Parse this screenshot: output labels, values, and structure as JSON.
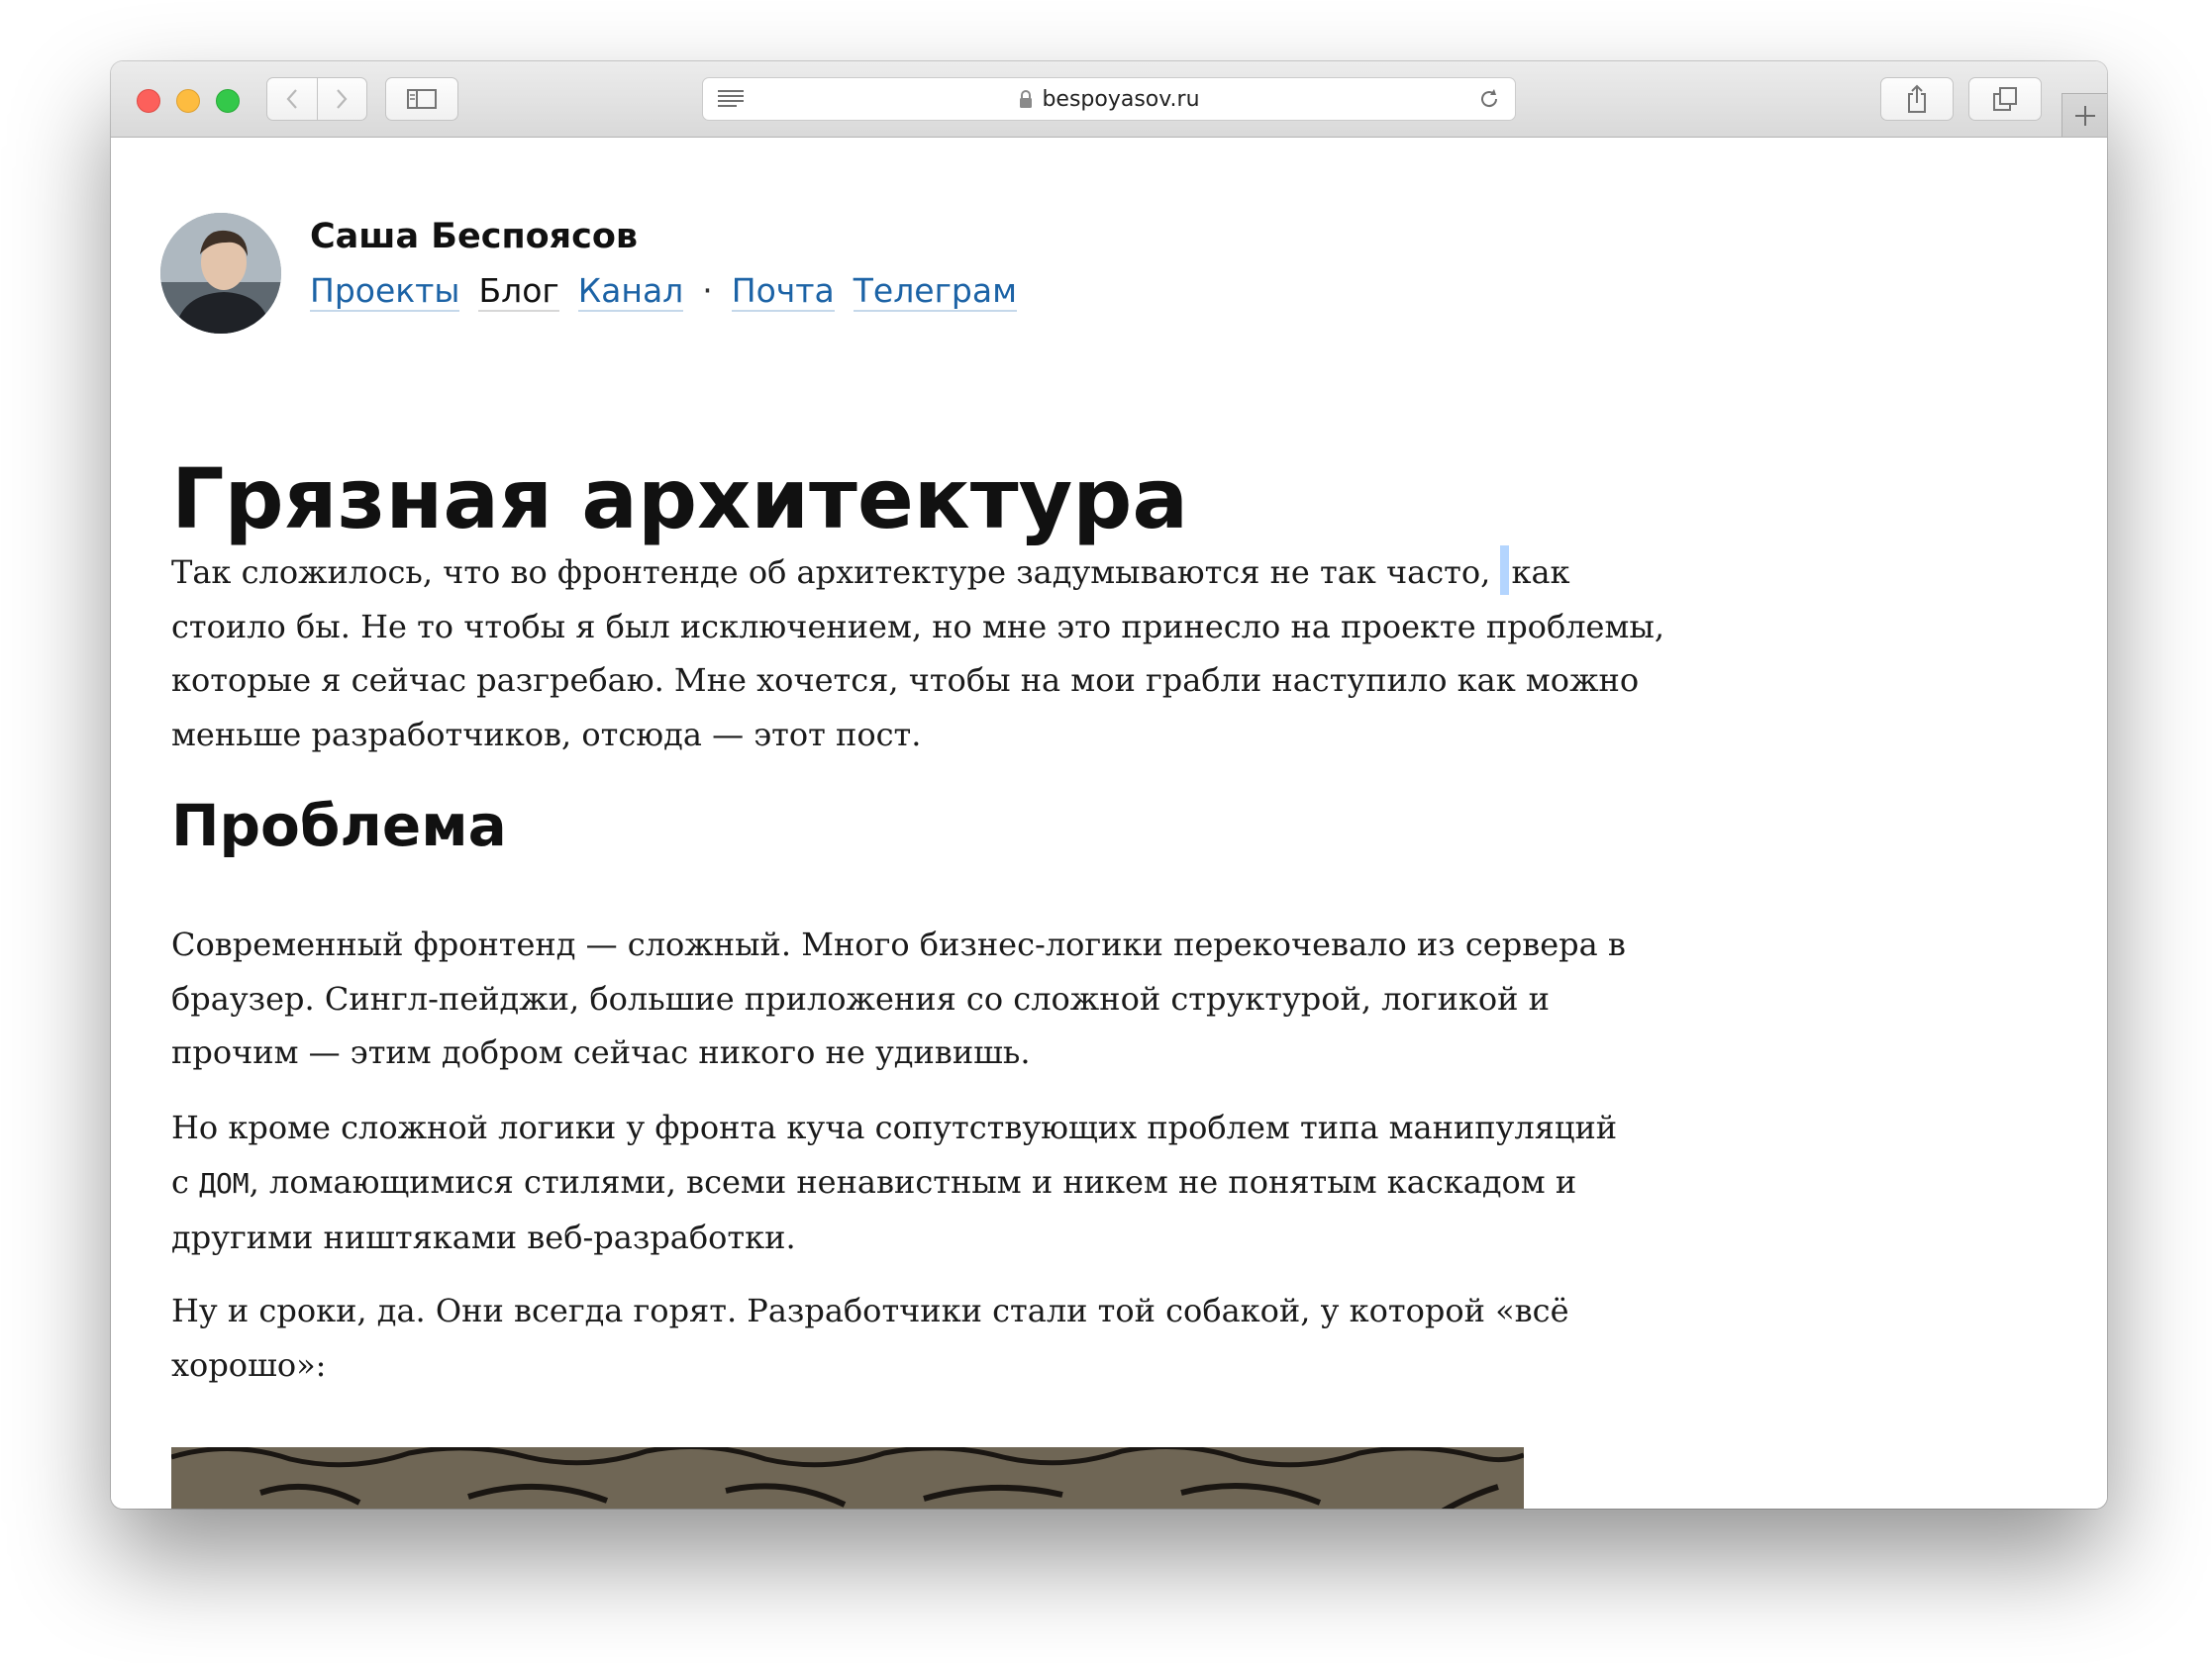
{
  "browser": {
    "url": "bespoyasov.ru",
    "colors": {
      "close": "#fc605b",
      "minimize": "#fdbc40",
      "maximize": "#34c84a"
    }
  },
  "site": {
    "author_name": "Саша Беспоясов",
    "nav": {
      "projects": "Проекты",
      "blog": "Блог",
      "channel": "Канал",
      "separator": "·",
      "mail": "Почта",
      "telegram": "Телеграм"
    },
    "link_color": "#1c63a6"
  },
  "article": {
    "title": "Грязная архитектура",
    "intro_before_caret": "Так сложилось, что во фронтенде об архитектуре задумываются не так часто, ",
    "intro_after_caret": "как стоило бы. Не то чтобы я был исключением, но мне это принесло на проекте проблемы, которые я сейчас разгребаю. Мне хочется, чтобы на мои грабли наступило как можно меньше разработчиков, отсюда — этот пост.",
    "section_title": "Проблема",
    "p2": "Современный фронтенд — сложный. Много бизнес-логики перекочевало из сервера в браузер. Сингл-пейджи, большие приложения со сложной структурой, логикой и прочим — этим добром сейчас никого не удивишь.",
    "p3_before_code": "Но кроме сложной логики у фронта куча сопутствующих проблем типа манипуляций с ",
    "p3_code": "ДОМ",
    "p3_after_code": ", ломающимися стилями, всеми ненавистным и никем не понятым каскадом и другими ништяками веб-разработки.",
    "p4": "Ну и сроки, да. Они всегда горят. Разработчики стали той собакой, у которой «всё хорошо»:"
  },
  "icons": {
    "back": "chevron-left-icon",
    "forward": "chevron-right-icon",
    "sidebar": "sidebar-icon",
    "reader": "reader-icon",
    "lock": "lock-icon",
    "reload": "reload-icon",
    "share": "share-icon",
    "tabs": "tabs-icon",
    "new_tab": "plus-icon"
  }
}
